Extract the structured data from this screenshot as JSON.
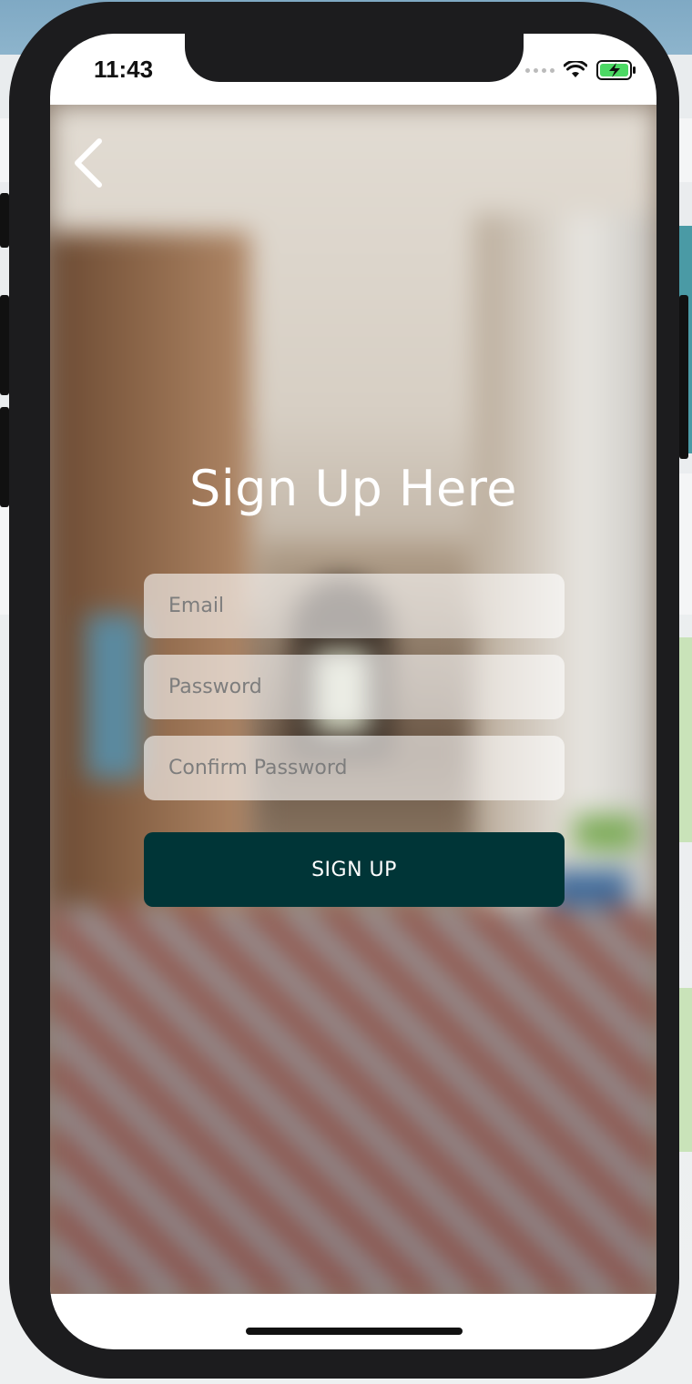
{
  "status_bar": {
    "time": "11:43",
    "icons": [
      "signal-dots-icon",
      "wifi-icon",
      "battery-charging-icon"
    ]
  },
  "navigation": {
    "back_icon": "chevron-left-icon"
  },
  "form": {
    "title": "Sign Up Here",
    "email_placeholder": "Email",
    "password_placeholder": "Password",
    "confirm_password_placeholder": "Confirm Password",
    "submit_label": "SIGN UP"
  },
  "colors": {
    "button_background": "#003537",
    "button_text": "#ffffff",
    "title_text": "#ffffff",
    "battery_fill": "#4cd964"
  }
}
